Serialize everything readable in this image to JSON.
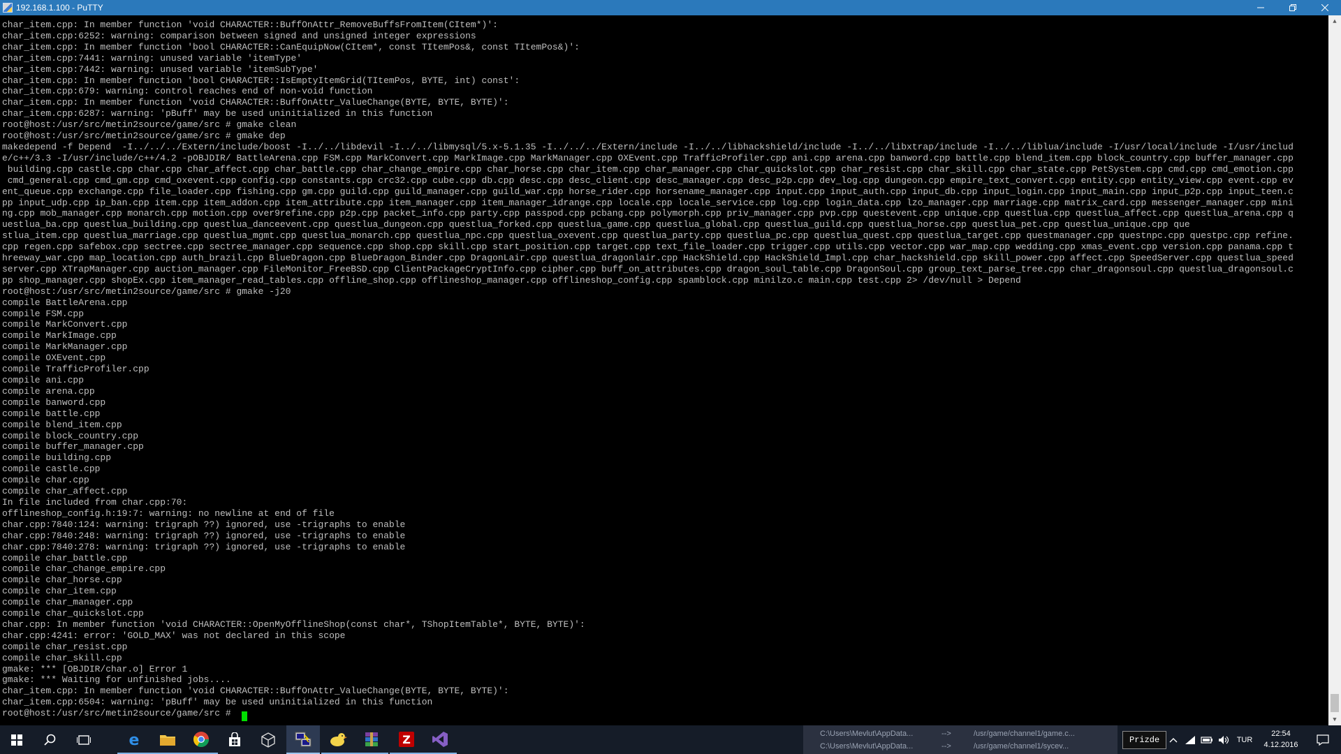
{
  "window": {
    "title": "192.168.1.100 - PuTTY",
    "minimize_icon": "minimize-icon",
    "maximize_icon": "restore-icon",
    "close_icon": "close-icon"
  },
  "terminal": {
    "lines": [
      "char_item.cpp: In member function 'void CHARACTER::BuffOnAttr_RemoveBuffsFromItem(CItem*)':",
      "char_item.cpp:6252: warning: comparison between signed and unsigned integer expressions",
      "char_item.cpp: In member function 'bool CHARACTER::CanEquipNow(CItem*, const TItemPos&, const TItemPos&)':",
      "char_item.cpp:7441: warning: unused variable 'itemType'",
      "char_item.cpp:7442: warning: unused variable 'itemSubType'",
      "char_item.cpp: In member function 'bool CHARACTER::IsEmptyItemGrid(TItemPos, BYTE, int) const':",
      "char_item.cpp:679: warning: control reaches end of non-void function",
      "char_item.cpp: In member function 'void CHARACTER::BuffOnAttr_ValueChange(BYTE, BYTE, BYTE)':",
      "char_item.cpp:6287: warning: 'pBuff' may be used uninitialized in this function",
      "root@host:/usr/src/metin2source/game/src # gmake clean",
      "root@host:/usr/src/metin2source/game/src # gmake dep",
      "makedepend -f Depend  -I../../../Extern/include/boost -I../../libdevil -I../../libmysql/5.x-5.1.35 -I../../../Extern/include -I../../libhackshield/include -I../../libxtrap/include -I../../liblua/include -I/usr/local/include -I/usr/includ",
      "e/c++/3.3 -I/usr/include/c++/4.2 -pOBJDIR/ BattleArena.cpp FSM.cpp MarkConvert.cpp MarkImage.cpp MarkManager.cpp OXEvent.cpp TrafficProfiler.cpp ani.cpp arena.cpp banword.cpp battle.cpp blend_item.cpp block_country.cpp buffer_manager.cpp",
      " building.cpp castle.cpp char.cpp char_affect.cpp char_battle.cpp char_change_empire.cpp char_horse.cpp char_item.cpp char_manager.cpp char_quickslot.cpp char_resist.cpp char_skill.cpp char_state.cpp PetSystem.cpp cmd.cpp cmd_emotion.cpp",
      " cmd_general.cpp cmd_gm.cpp cmd_oxevent.cpp config.cpp constants.cpp crc32.cpp cube.cpp db.cpp desc.cpp desc_client.cpp desc_manager.cpp desc_p2p.cpp dev_log.cpp dungeon.cpp empire_text_convert.cpp entity.cpp entity_view.cpp event.cpp ev",
      "ent_queue.cpp exchange.cpp file_loader.cpp fishing.cpp gm.cpp guild.cpp guild_manager.cpp guild_war.cpp horse_rider.cpp horsename_manager.cpp input.cpp input_auth.cpp input_db.cpp input_login.cpp input_main.cpp input_p2p.cpp input_teen.c",
      "pp input_udp.cpp ip_ban.cpp item.cpp item_addon.cpp item_attribute.cpp item_manager.cpp item_manager_idrange.cpp locale.cpp locale_service.cpp log.cpp login_data.cpp lzo_manager.cpp marriage.cpp matrix_card.cpp messenger_manager.cpp mini",
      "ng.cpp mob_manager.cpp monarch.cpp motion.cpp over9refine.cpp p2p.cpp packet_info.cpp party.cpp passpod.cpp pcbang.cpp polymorph.cpp priv_manager.cpp pvp.cpp questevent.cpp unique.cpp questlua.cpp questlua_affect.cpp questlua_arena.cpp q",
      "uestlua_ba.cpp questlua_building.cpp questlua_danceevent.cpp questlua_dungeon.cpp questlua_forked.cpp questlua_game.cpp questlua_global.cpp questlua_guild.cpp questlua_horse.cpp questlua_pet.cpp questlua_unique.cpp que",
      "stlua_item.cpp questlua_marriage.cpp questlua_mgmt.cpp questlua_monarch.cpp questlua_npc.cpp questlua_oxevent.cpp questlua_party.cpp questlua_pc.cpp questlua_quest.cpp questlua_target.cpp questmanager.cpp questnpc.cpp questpc.cpp refine.",
      "cpp regen.cpp safebox.cpp sectree.cpp sectree_manager.cpp sequence.cpp shop.cpp skill.cpp start_position.cpp target.cpp text_file_loader.cpp trigger.cpp utils.cpp vector.cpp war_map.cpp wedding.cpp xmas_event.cpp version.cpp panama.cpp t",
      "hreeway_war.cpp map_location.cpp auth_brazil.cpp BlueDragon.cpp BlueDragon_Binder.cpp DragonLair.cpp questlua_dragonlair.cpp HackShield.cpp HackShield_Impl.cpp char_hackshield.cpp skill_power.cpp affect.cpp SpeedServer.cpp questlua_speed",
      "server.cpp XTrapManager.cpp auction_manager.cpp FileMonitor_FreeBSD.cpp ClientPackageCryptInfo.cpp cipher.cpp buff_on_attributes.cpp dragon_soul_table.cpp DragonSoul.cpp group_text_parse_tree.cpp char_dragonsoul.cpp questlua_dragonsoul.c",
      "pp shop_manager.cpp shopEx.cpp item_manager_read_tables.cpp offline_shop.cpp offlineshop_manager.cpp offlineshop_config.cpp spamblock.cpp minilzo.c main.cpp test.cpp 2> /dev/null > Depend",
      "root@host:/usr/src/metin2source/game/src # gmake -j20",
      "compile BattleArena.cpp",
      "compile FSM.cpp",
      "compile MarkConvert.cpp",
      "compile MarkImage.cpp",
      "compile MarkManager.cpp",
      "compile OXEvent.cpp",
      "compile TrafficProfiler.cpp",
      "compile ani.cpp",
      "compile arena.cpp",
      "compile banword.cpp",
      "compile battle.cpp",
      "compile blend_item.cpp",
      "compile block_country.cpp",
      "compile buffer_manager.cpp",
      "compile building.cpp",
      "compile castle.cpp",
      "compile char.cpp",
      "compile char_affect.cpp",
      "In file included from char.cpp:70:",
      "offlineshop_config.h:19:7: warning: no newline at end of file",
      "char.cpp:7840:124: warning: trigraph ??) ignored, use -trigraphs to enable",
      "char.cpp:7840:248: warning: trigraph ??) ignored, use -trigraphs to enable",
      "char.cpp:7840:278: warning: trigraph ??) ignored, use -trigraphs to enable",
      "compile char_battle.cpp",
      "compile char_change_empire.cpp",
      "compile char_horse.cpp",
      "compile char_item.cpp",
      "compile char_manager.cpp",
      "compile char_quickslot.cpp",
      "char.cpp: In member function 'void CHARACTER::OpenMyOfflineShop(const char*, TShopItemTable*, BYTE, BYTE)':",
      "char.cpp:4241: error: 'GOLD_MAX' was not declared in this scope",
      "compile char_resist.cpp",
      "compile char_skill.cpp",
      "gmake: *** [OBJDIR/char.o] Error 1",
      "gmake: *** Waiting for unfinished jobs....",
      "char_item.cpp: In member function 'void CHARACTER::BuffOnAttr_ValueChange(BYTE, BYTE, BYTE)':",
      "char_item.cpp:6504: warning: 'pBuff' may be used uninitialized in this function",
      "root@host:/usr/src/metin2source/game/src # "
    ],
    "text_color": "#bfbfbf",
    "cursor_color": "#00e000"
  },
  "taskbar": {
    "apps": [
      {
        "name": "start-icon"
      },
      {
        "name": "search-icon"
      },
      {
        "name": "task-view-icon"
      },
      {
        "name": "edge-icon"
      },
      {
        "name": "file-explorer-icon"
      },
      {
        "name": "chrome-icon"
      },
      {
        "name": "store-icon"
      },
      {
        "name": "cube-icon"
      },
      {
        "name": "putty-icon"
      },
      {
        "name": "duck-app-icon"
      },
      {
        "name": "winrar-icon"
      },
      {
        "name": "filezilla-icon"
      },
      {
        "name": "visual-studio-icon"
      }
    ],
    "peek_lines": [
      "C:\\Users\\Mevlut\\AppData...",
      "-->",
      "/usr/game/channel1/game.c...",
      "C:\\Users\\Mevlut\\AppData...",
      "-->",
      "/usr/game/channel1/sycev..."
    ],
    "tooltip": "Prizde",
    "language": "TUR",
    "time": "22:54",
    "date": "4.12.2016",
    "accent_color": "#2b79bb"
  }
}
